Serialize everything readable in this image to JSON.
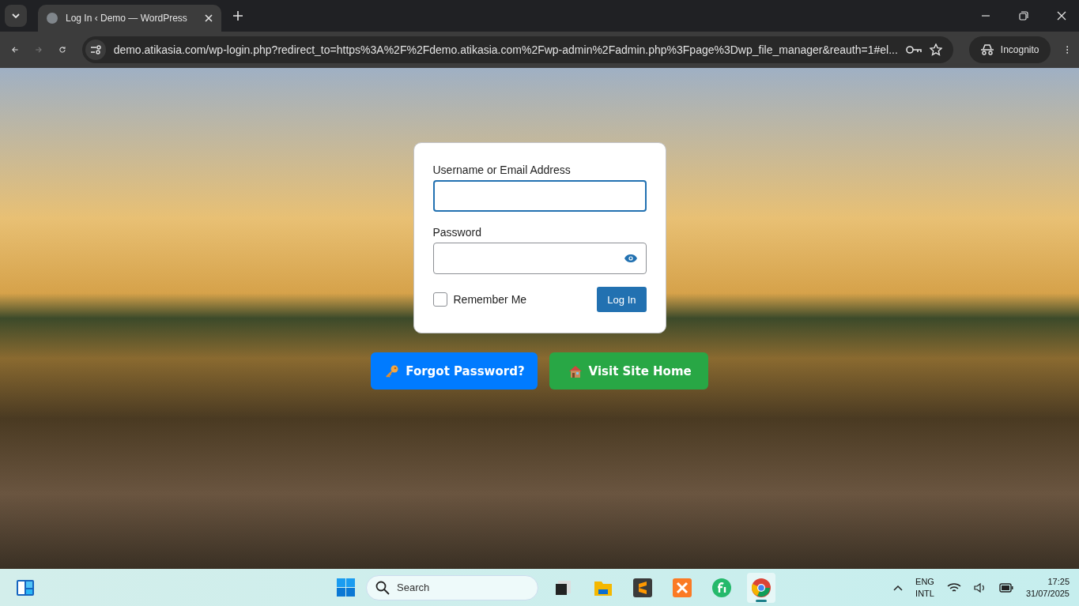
{
  "browser": {
    "tab_title": "Log In ‹ Demo — WordPress",
    "url": "demo.atikasia.com/wp-login.php?redirect_to=https%3A%2F%2Fdemo.atikasia.com%2Fwp-admin%2Fadmin.php%3Fpage%3Dwp_file_manager&reauth=1#el...",
    "profile_label": "Incognito"
  },
  "login_form": {
    "username_label": "Username or Email Address",
    "password_label": "Password",
    "remember_label": "Remember Me",
    "remember_checked": false,
    "submit_label": "Log In"
  },
  "links": [
    {
      "kind": "forgot",
      "label": "Forgot Password?"
    },
    {
      "kind": "home",
      "label": "Visit Site Home"
    }
  ],
  "taskbar": {
    "search_placeholder": "Search",
    "apps": [
      {
        "kind": "windows",
        "selected": false
      },
      {
        "kind": "files",
        "selected": false
      },
      {
        "kind": "sublime",
        "selected": false
      },
      {
        "kind": "xampp",
        "selected": false
      },
      {
        "kind": "fi",
        "selected": false
      },
      {
        "kind": "chrome",
        "selected": true
      }
    ],
    "language": "ENG",
    "layout": "INTL",
    "time": "17:25",
    "date": "31/07/2025"
  }
}
